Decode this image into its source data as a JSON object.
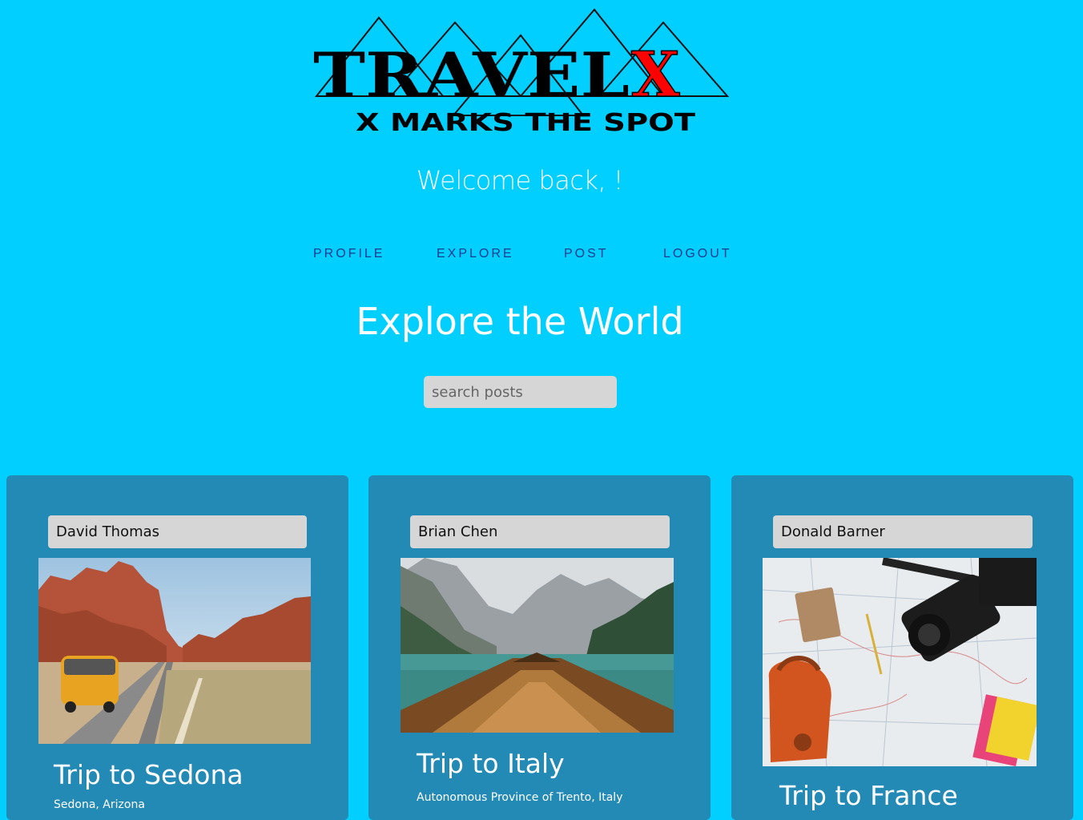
{
  "logo": {
    "title_main": "TRAVEL",
    "title_x": "X",
    "tagline": "X MARKS THE SPOT"
  },
  "welcome": "Welcome back, !",
  "nav": {
    "profile": "PROFILE",
    "explore": "EXPLORE",
    "post": "POST",
    "logout": "LOGOUT"
  },
  "page_title": "Explore the World",
  "search": {
    "placeholder": "search posts",
    "value": ""
  },
  "posts": [
    {
      "author": "David Thomas",
      "title": "Trip to Sedona",
      "location": "Sedona, Arizona",
      "image": "desert-road-van-photo"
    },
    {
      "author": "Brian Chen",
      "title": "Trip to Italy",
      "location": "Autonomous Province of Trento, Italy",
      "image": "mountain-lake-boat-photo"
    },
    {
      "author": "Donald Barner",
      "title": "Trip to France",
      "location": "",
      "image": "map-camera-backpack-photo"
    }
  ],
  "colors": {
    "background": "#00cfff",
    "card": "#2389b5",
    "nav_link": "#1a3a8c",
    "logo_accent": "#ff0000"
  }
}
